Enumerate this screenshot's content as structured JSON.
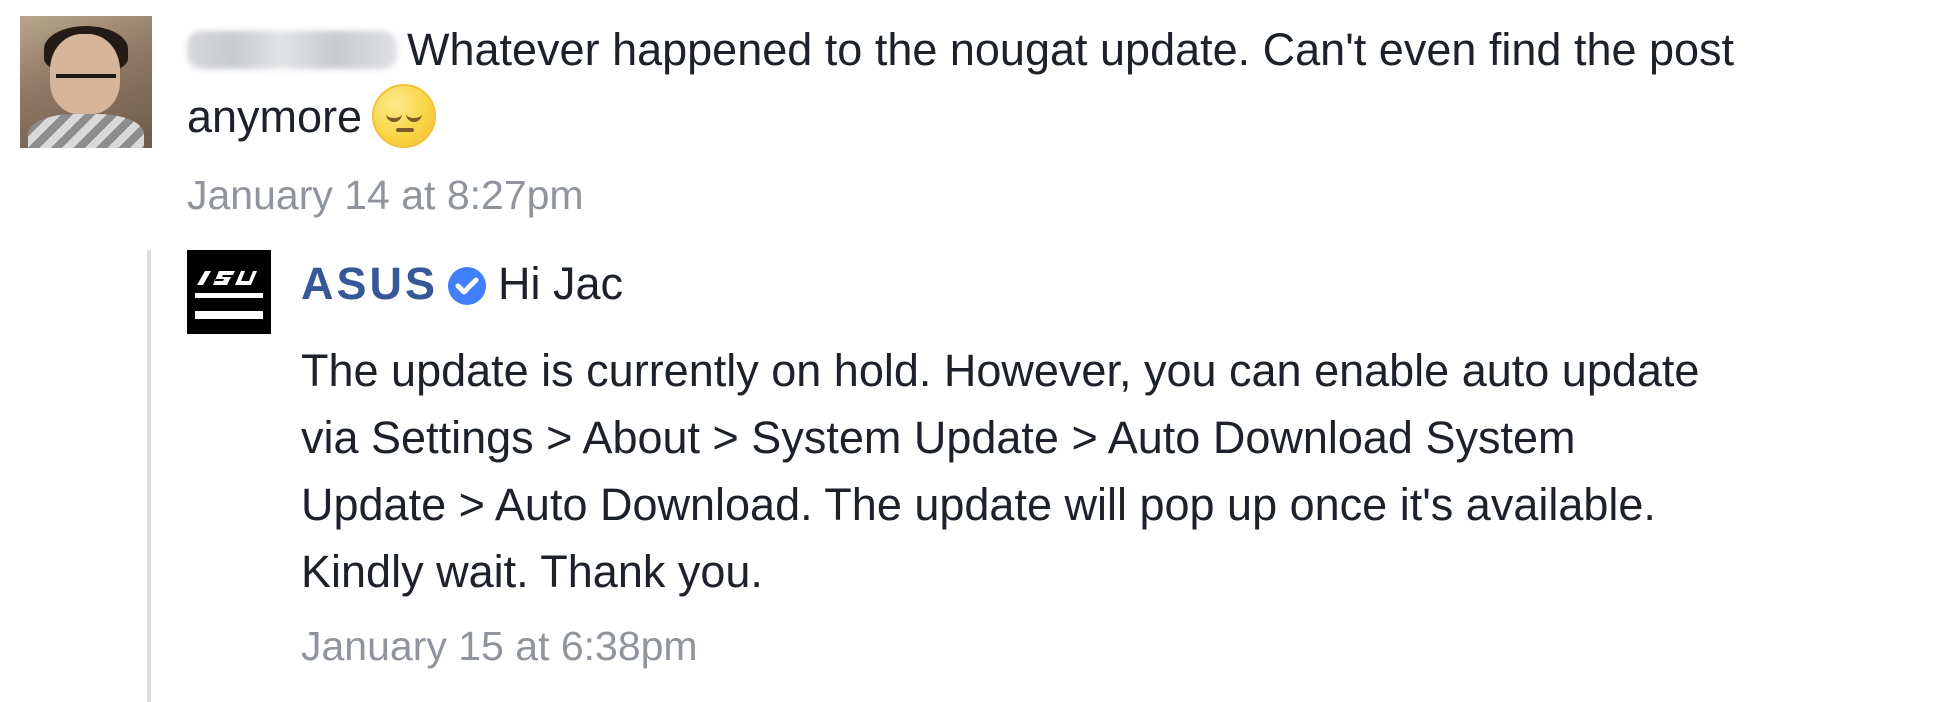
{
  "comment": {
    "text_line_one": "Whatever happened to the nougat update. Can't even find the post",
    "text_line_two": "anymore",
    "timestamp": "January 14 at 8:27pm",
    "avatar_icon": "user-avatar-icon",
    "emoji_icon": "pensive-face-emoji"
  },
  "reply": {
    "author": "ASUS",
    "greeting": "Hi Jac",
    "verified_icon": "verified-badge-icon",
    "logo_icon": "asus-logo-icon",
    "body_lines": [
      "The update is currently on hold. However, you can enable auto update",
      "via Settings > About > System Update > Auto Download System",
      "Update > Auto Download. The update will pop up once it's available.",
      "Kindly wait. Thank you."
    ],
    "timestamp": "January 15 at 6:38pm"
  },
  "colors": {
    "author_link": "#365899",
    "timestamp": "#90949c",
    "body_text": "#1d2129",
    "verified_badge": "#4080ff",
    "thread_rail": "#dddfe2"
  }
}
